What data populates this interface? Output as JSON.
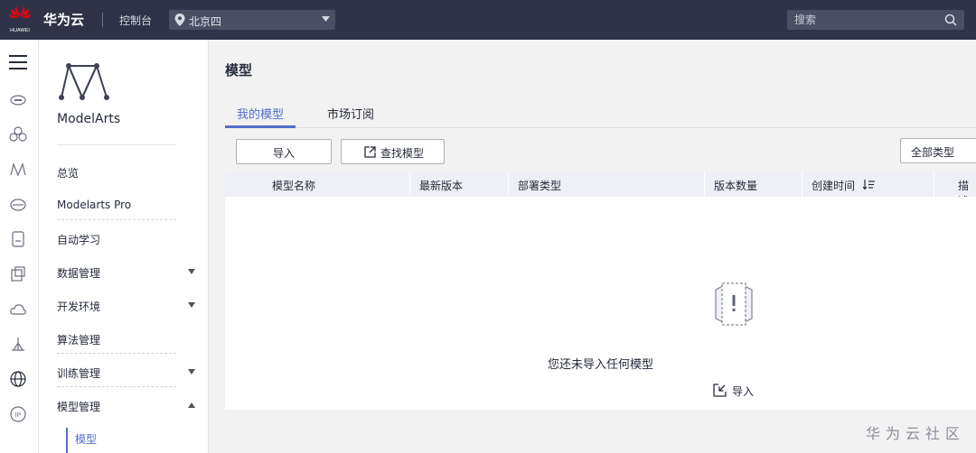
{
  "topbar": {
    "brand": "华为云",
    "logo_text": "HUAWEI",
    "console": "控制台",
    "region": "北京四",
    "search_placeholder": "搜索"
  },
  "rail": {
    "icons": [
      "menu-icon",
      "cloud-server-icon",
      "cluster-icon",
      "modelarts-icon",
      "storage-icon",
      "document-icon",
      "service-icon",
      "cloud-icon",
      "tent-icon",
      "globe-icon",
      "ip-icon"
    ]
  },
  "service": {
    "name": "ModelArts"
  },
  "nav": {
    "items": [
      {
        "label": "总览"
      },
      {
        "label": "Modelarts Pro"
      },
      {
        "label": "自动学习"
      },
      {
        "label": "数据管理"
      },
      {
        "label": "开发环境"
      },
      {
        "label": "算法管理"
      },
      {
        "label": "训练管理"
      },
      {
        "label": "模型管理"
      }
    ],
    "sub_item": "模型"
  },
  "main": {
    "title": "模型",
    "tabs": [
      {
        "label": "我的模型",
        "active": true
      },
      {
        "label": "市场订阅",
        "active": false
      }
    ],
    "toolbar": {
      "import_label": "导入",
      "find_label": "查找模型",
      "type_filter": "全部类型"
    },
    "table": {
      "columns": [
        "模型名称",
        "最新版本",
        "部署类型",
        "版本数量",
        "创建时间",
        "描述"
      ]
    },
    "empty": {
      "message": "您还未导入任何模型",
      "action": "导入"
    }
  },
  "watermark": "华为云社区",
  "colors": {
    "topbar": "#2f3347",
    "accent": "#526ecc",
    "background": "#f2f2f2"
  }
}
